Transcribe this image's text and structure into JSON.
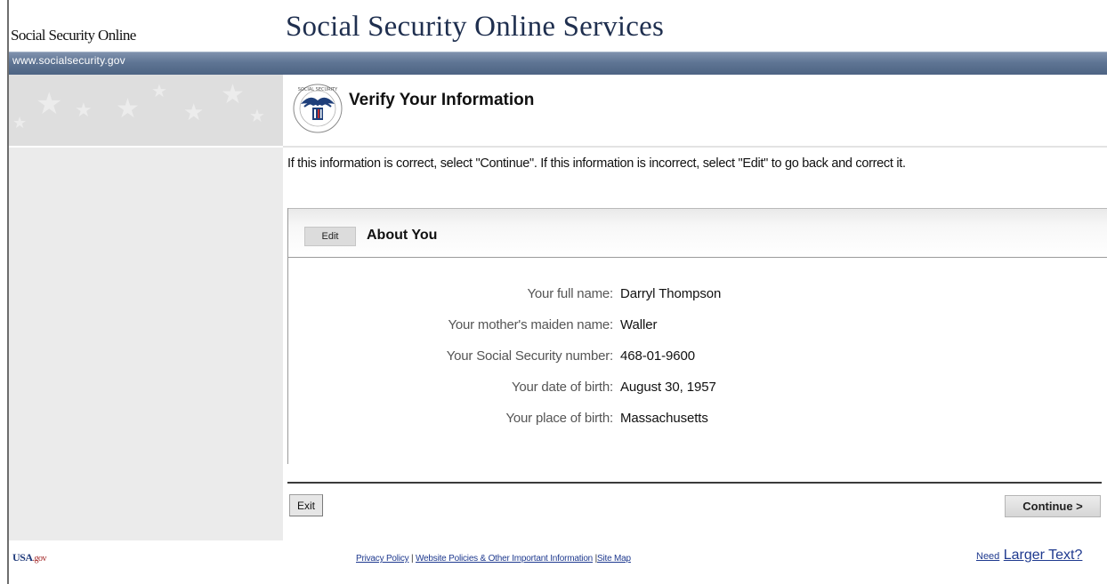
{
  "header": {
    "brand": "Social Security Online",
    "site_title": "Social Security Online Services",
    "url": "www.socialsecurity.gov"
  },
  "page": {
    "heading": "Verify Your Information",
    "instruction": "If this information is correct, select \"Continue\". If this information is incorrect, select \"Edit\" to go back and correct it."
  },
  "section": {
    "edit_label": "Edit",
    "title": "About You",
    "rows": [
      {
        "label": "Your full name:",
        "value": "Darryl Thompson"
      },
      {
        "label": "Your mother's maiden name:",
        "value": "Waller"
      },
      {
        "label": "Your Social Security number:",
        "value": "468-01-9600"
      },
      {
        "label": "Your date of birth:",
        "value": "August 30, 1957"
      },
      {
        "label": "Your place of birth:",
        "value": "Massachusetts"
      }
    ]
  },
  "actions": {
    "exit_label": "Exit",
    "continue_label": "Continue >"
  },
  "footer": {
    "usagov": "USA",
    "usagov_suffix": ".gov",
    "privacy": "Privacy Policy",
    "policies": "Website Policies & Other Important Information",
    "sitemap": "Site Map",
    "sep1": " | ",
    "sep2": " |",
    "need": "Need",
    "larger": "Larger Text?"
  }
}
